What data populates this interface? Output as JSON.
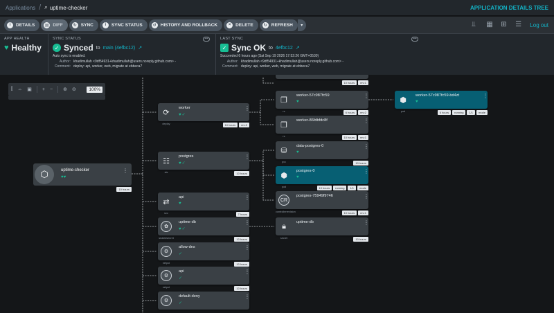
{
  "breadcrumb": {
    "root": "Applications",
    "current": "uptime-checker"
  },
  "header_right": "APPLICATION DETAILS TREE",
  "toolbar": {
    "details": "DETAILS",
    "diff": "DIFF",
    "sync": "SYNC",
    "sync_status": "SYNC STATUS",
    "history": "HISTORY AND ROLLBACK",
    "delete": "DELETE",
    "refresh": "REFRESH",
    "logout": "Log out"
  },
  "app_health": {
    "label": "APP HEALTH",
    "value": "Healthy"
  },
  "sync_status": {
    "label": "SYNC STATUS",
    "value": "Synced",
    "to": "to",
    "rev": "main (4efbc12)",
    "note": "Auto sync is enabled.",
    "author_k": "Author:",
    "author": "khadimullah <9df54931+khadimullah@users.noreply.github.com> -",
    "comment_k": "Comment:",
    "comment": "deploy: api, worker, web, migrate at ebbeca7"
  },
  "last_sync": {
    "label": "LAST SYNC",
    "value": "Sync OK",
    "to": "to",
    "rev": "4efbc12",
    "note": "Succeeded 6 hours ago (Sat Sep 19 2026 17:52:26 GMT+0530)",
    "author_k": "Author:",
    "author": "khadimullah <9df54931+khadimullah@users.noreply.github.com> -",
    "comment_k": "Comment:",
    "comment": "deploy: api, worker, web, migrate at ebbeca7"
  },
  "zoom": "100%",
  "nodes": {
    "app": {
      "name": "uptime-checker",
      "age": "10 hours"
    },
    "worker": {
      "name": "worker",
      "kind": "deploy",
      "age": "10 hours",
      "rev": "rev:2"
    },
    "postgres": {
      "name": "postgres",
      "kind": "sts",
      "age": "10 hours"
    },
    "api": {
      "name": "api",
      "kind": "svc",
      "age": "7 hours"
    },
    "uptimedb": {
      "name": "uptime-db",
      "kind": "sealedsecret",
      "age": "10 hours"
    },
    "allowdns": {
      "name": "allow-dns",
      "kind": "netpol",
      "age": "10 hours"
    },
    "apinp": {
      "name": "api",
      "kind": "netpol",
      "age": "10 hours"
    },
    "defaultdeny": {
      "name": "default-deny",
      "kind": "netpol",
      "age": "10 hours"
    },
    "rs1top": {
      "age": "10 hours",
      "rev": "rev:1"
    },
    "rs1": {
      "name": "worker-57c987fc59",
      "kind": "rs",
      "age": "6 hours",
      "rev": "rev:2"
    },
    "rs2": {
      "name": "worker-86fdbfdc8f",
      "kind": "rs",
      "age": "10 hours",
      "rev": "rev:1"
    },
    "pvc": {
      "name": "data-postgres-0",
      "kind": "pvc",
      "age": "10 hours"
    },
    "pg0": {
      "name": "postgres-0",
      "kind": "pod",
      "age": "10 hours",
      "status": "running",
      "ready": "1/1",
      "mode": "mode"
    },
    "cr": {
      "name": "postgres-75949f9746",
      "kind": "controllerrevision",
      "age": "10 hours",
      "rev": "rev:1",
      "icon": "CR"
    },
    "secret": {
      "name": "uptime-db",
      "kind": "secret",
      "age": "10 hours"
    },
    "pod": {
      "name": "worker-57c987fc59-bd4zt",
      "kind": "pod",
      "age": "6 hours",
      "status": "running",
      "ready": "1/1",
      "mode": "mode"
    }
  }
}
